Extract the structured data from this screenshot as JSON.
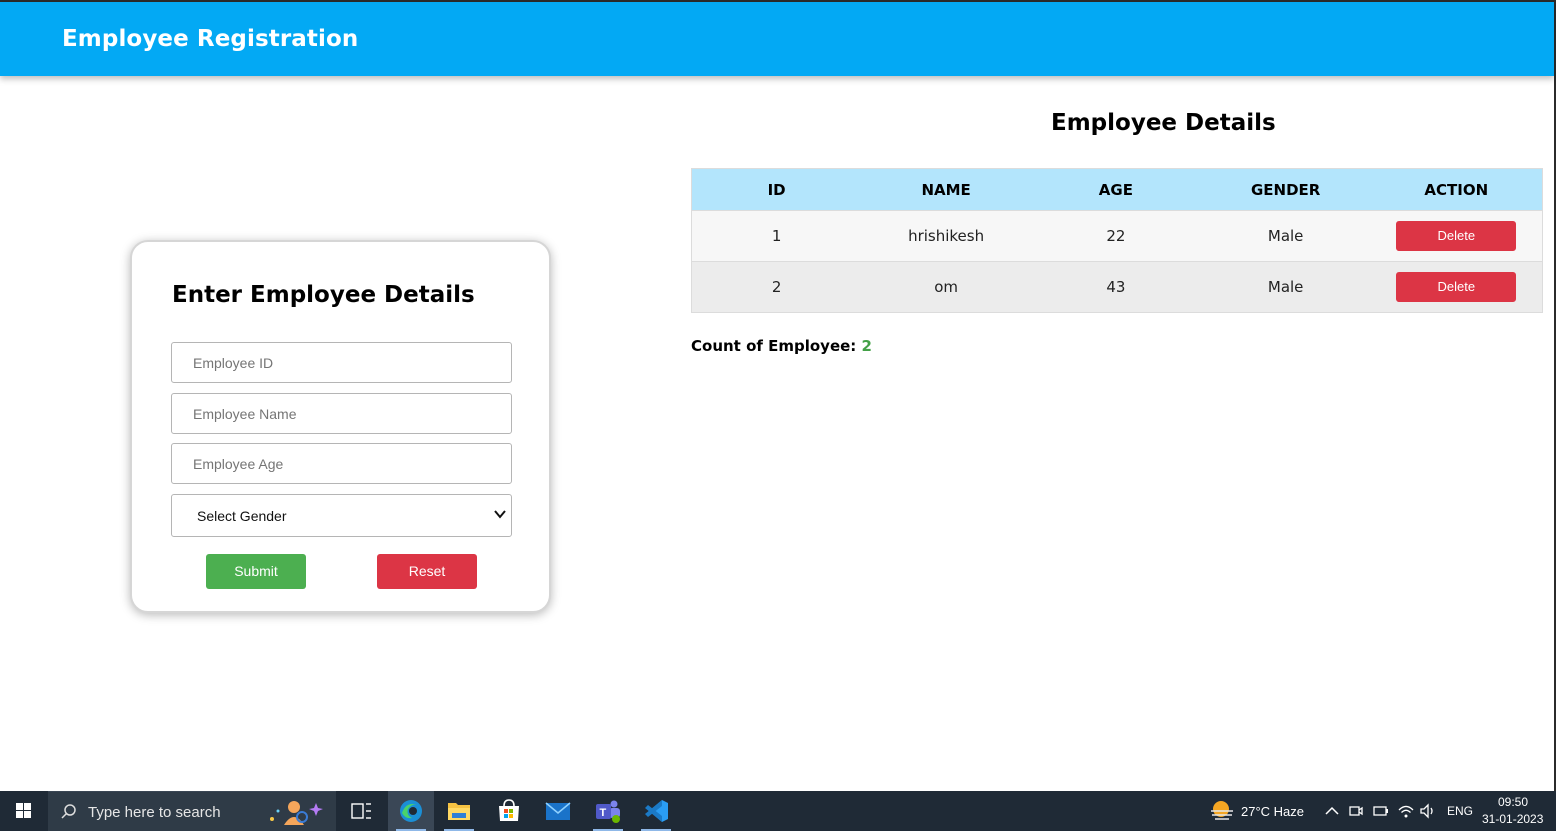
{
  "app": {
    "title": "Employee Registration"
  },
  "form": {
    "title": "Enter Employee Details",
    "id_placeholder": "Employee ID",
    "name_placeholder": "Employee Name",
    "age_placeholder": "Employee Age",
    "gender_selected": "Select Gender",
    "submit_label": "Submit",
    "reset_label": "Reset"
  },
  "details": {
    "title": "Employee Details",
    "columns": [
      "ID",
      "NAME",
      "AGE",
      "GENDER",
      "ACTION"
    ],
    "rows": [
      {
        "id": "1",
        "name": "hrishikesh",
        "age": "22",
        "gender": "Male",
        "action": "Delete"
      },
      {
        "id": "2",
        "name": "om",
        "age": "43",
        "gender": "Male",
        "action": "Delete"
      }
    ],
    "count_label": "Count of Employee:",
    "count_value": "2"
  },
  "taskbar": {
    "search_placeholder": "Type here to search",
    "weather": "27°C  Haze",
    "language": "ENG",
    "time": "09:50",
    "date": "31-01-2023",
    "apps": [
      "edge-icon",
      "file-explorer-icon",
      "store-icon",
      "mail-icon",
      "teams-icon",
      "vscode-icon"
    ]
  },
  "colors": {
    "header": "#03a9f4",
    "table_header": "#b3e5fc",
    "submit": "#4caf50",
    "reset": "#dc3545",
    "delete": "#dc3545",
    "count": "#43a047"
  }
}
